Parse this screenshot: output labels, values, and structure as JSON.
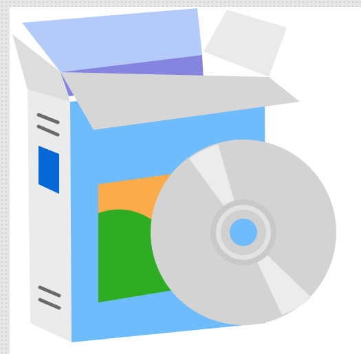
{
  "illustration": {
    "subject": "software-box-with-disc-icon",
    "colors": {
      "frame": "#e6e6e6",
      "box_front": "#6ebcfc",
      "box_side": "#ebebeb",
      "box_flap_back": "#b4cbfa",
      "box_inner": "#8585e0",
      "box_flap": "#dcdcdc",
      "side_label": "#0567d6",
      "artwork_orange": "#fcab4a",
      "artwork_green": "#2fad22",
      "disc": "#d3d3d3",
      "disc_highlight": "#ececec",
      "disc_hub": "#6ebcfc"
    }
  }
}
